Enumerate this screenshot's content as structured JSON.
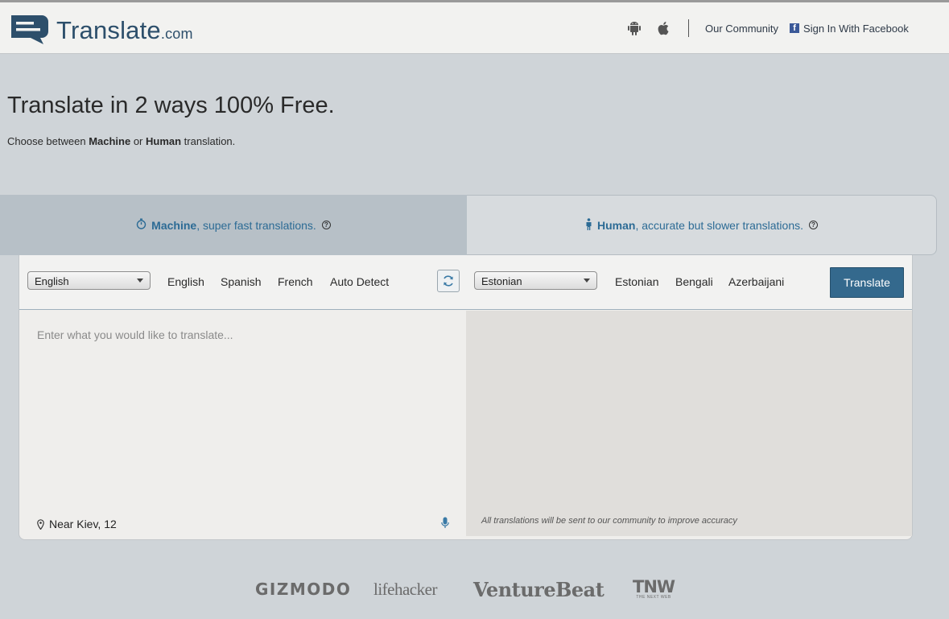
{
  "header": {
    "logo_text": "Translate",
    "logo_domain": ".com",
    "icons": [
      "android-icon",
      "apple-icon"
    ],
    "community_link": "Our Community",
    "facebook_icon_letter": "f",
    "facebook_link": "Sign In With Facebook"
  },
  "hero": {
    "title": "Translate in 2 ways 100% Free.",
    "sub_before": "Choose between ",
    "sub_machine": "Machine",
    "sub_or": " or ",
    "sub_human": "Human",
    "sub_after": " translation."
  },
  "modes": {
    "machine": {
      "bold": "Machine",
      "rest": ", super fast translations.",
      "help": "?"
    },
    "human": {
      "bold": "Human",
      "rest": ", accurate but slower translations.",
      "help": "?"
    }
  },
  "translator": {
    "source_language": "English",
    "source_quick": [
      "English",
      "Spanish",
      "French",
      "Auto Detect"
    ],
    "target_language": "Estonian",
    "target_quick": [
      "Estonian",
      "Bengali",
      "Azerbaijani"
    ],
    "translate_button": "Translate",
    "source_placeholder": "Enter what you would like to translate...",
    "location": "Near Kiev, 12",
    "community_note": "All translations will be sent to our community to improve accuracy"
  },
  "press": {
    "gizmodo": "GIZMODO",
    "lifehacker": "lifehacker",
    "venturebeat": "VentureBeat",
    "tnw": "TNW",
    "tnw_sub": "THE NEXT WEB"
  },
  "colors": {
    "brand_blue": "#2d4f6b",
    "button_blue": "#34698d",
    "link_blue": "#2c6b95"
  }
}
